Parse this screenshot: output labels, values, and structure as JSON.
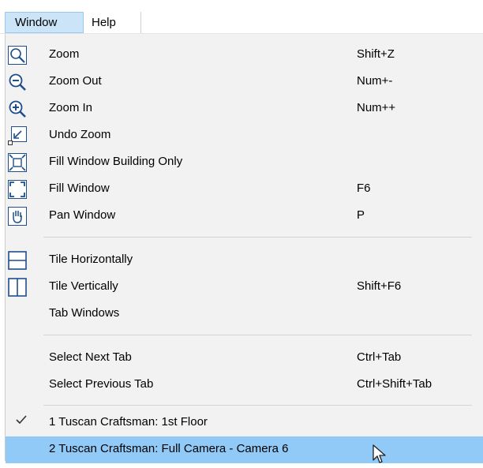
{
  "menubar": {
    "items": [
      "Window",
      "Help"
    ]
  },
  "menu": {
    "items": [
      {
        "label": "Zoom",
        "shortcut": "Shift+Z",
        "icon": "zoom-icon"
      },
      {
        "label": "Zoom Out",
        "shortcut": "Num+-",
        "icon": "zoom-out-icon"
      },
      {
        "label": "Zoom In",
        "shortcut": "Num++",
        "icon": "zoom-in-icon"
      },
      {
        "label": "Undo Zoom",
        "shortcut": "",
        "icon": "undo-zoom-icon"
      },
      {
        "label": "Fill Window Building Only",
        "shortcut": "",
        "icon": "fill-window-building-icon"
      },
      {
        "label": "Fill Window",
        "shortcut": "F6",
        "icon": "fill-window-icon"
      },
      {
        "label": "Pan Window",
        "shortcut": "P",
        "icon": "pan-hand-icon"
      },
      {
        "label": "Tile Horizontally",
        "shortcut": "",
        "icon": "tile-horizontal-icon"
      },
      {
        "label": "Tile Vertically",
        "shortcut": "Shift+F6",
        "icon": "tile-vertical-icon"
      },
      {
        "label": "Tab Windows",
        "shortcut": ""
      },
      {
        "label": "Select Next Tab",
        "shortcut": "Ctrl+Tab"
      },
      {
        "label": "Select Previous Tab",
        "shortcut": "Ctrl+Shift+Tab"
      },
      {
        "label": "1 Tuscan Craftsman: 1st Floor",
        "checked": true
      },
      {
        "label": "2 Tuscan Craftsman: Full Camera - Camera 6",
        "highlighted": true
      }
    ]
  },
  "colors": {
    "menu_bg": "#f2f2f2",
    "highlight": "#91c9f7",
    "menubar_active": "#cce4f7",
    "icon_blue": "#1f4e8c"
  }
}
